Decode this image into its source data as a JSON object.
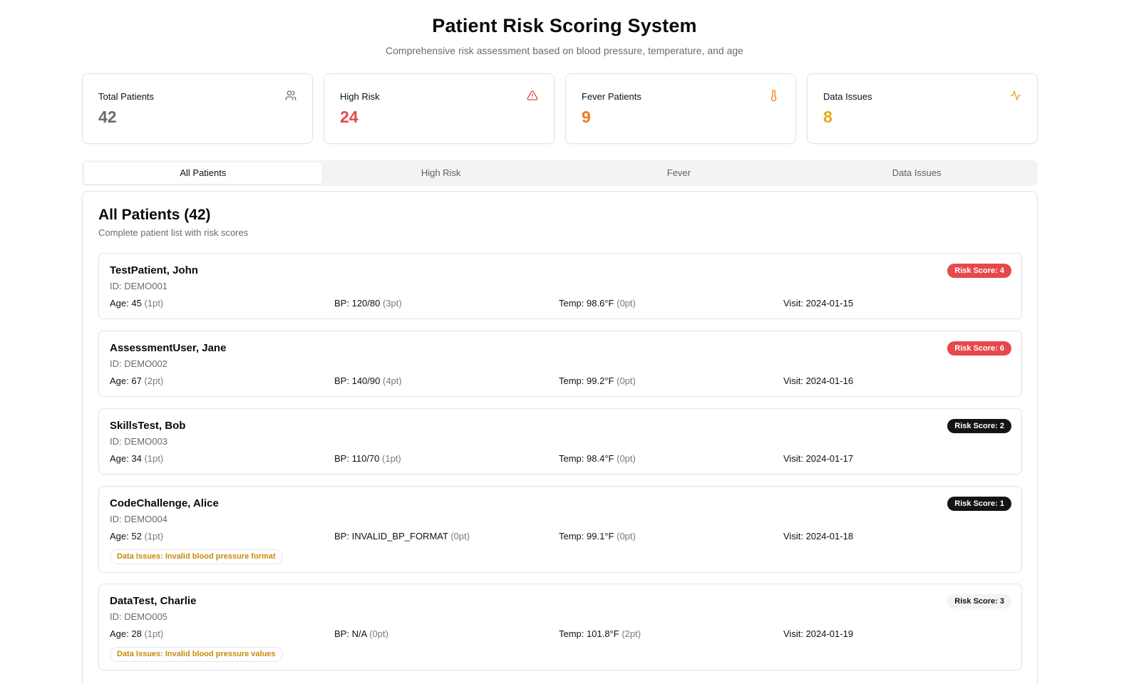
{
  "header": {
    "title": "Patient Risk Scoring System",
    "subtitle": "Comprehensive risk assessment based on blood pressure, temperature, and age"
  },
  "stats": [
    {
      "label": "Total Patients",
      "value": "42",
      "icon": "users-icon",
      "color": "#6b6b6b"
    },
    {
      "label": "High Risk",
      "value": "24",
      "icon": "alert-triangle-icon",
      "color": "#e5484d"
    },
    {
      "label": "Fever Patients",
      "value": "9",
      "icon": "thermometer-icon",
      "color": "#f27a1a"
    },
    {
      "label": "Data Issues",
      "value": "8",
      "icon": "activity-icon",
      "color": "#e6a817"
    }
  ],
  "tabs": [
    {
      "label": "All Patients",
      "active": true
    },
    {
      "label": "High Risk",
      "active": false
    },
    {
      "label": "Fever",
      "active": false
    },
    {
      "label": "Data Issues",
      "active": false
    }
  ],
  "panel": {
    "title": "All Patients (42)",
    "subtitle": "Complete patient list with risk scores"
  },
  "labels": {
    "age": "Age:",
    "bp": "BP:",
    "temp": "Temp:",
    "visit": "Visit:"
  },
  "patients": [
    {
      "name": "TestPatient, John",
      "id": "ID: DEMO001",
      "age": "45",
      "age_pt": "(1pt)",
      "bp": "120/80",
      "bp_pt": "(3pt)",
      "temp": "98.6°F",
      "temp_pt": "(0pt)",
      "visit": "2024-01-15",
      "risk": "Risk Score: 4",
      "risk_level": "high",
      "issue": ""
    },
    {
      "name": "AssessmentUser, Jane",
      "id": "ID: DEMO002",
      "age": "67",
      "age_pt": "(2pt)",
      "bp": "140/90",
      "bp_pt": "(4pt)",
      "temp": "99.2°F",
      "temp_pt": "(0pt)",
      "visit": "2024-01-16",
      "risk": "Risk Score: 6",
      "risk_level": "high",
      "issue": ""
    },
    {
      "name": "SkillsTest, Bob",
      "id": "ID: DEMO003",
      "age": "34",
      "age_pt": "(1pt)",
      "bp": "110/70",
      "bp_pt": "(1pt)",
      "temp": "98.4°F",
      "temp_pt": "(0pt)",
      "visit": "2024-01-17",
      "risk": "Risk Score: 2",
      "risk_level": "dark",
      "issue": ""
    },
    {
      "name": "CodeChallenge, Alice",
      "id": "ID: DEMO004",
      "age": "52",
      "age_pt": "(1pt)",
      "bp": "INVALID_BP_FORMAT",
      "bp_pt": "(0pt)",
      "temp": "99.1°F",
      "temp_pt": "(0pt)",
      "visit": "2024-01-18",
      "risk": "Risk Score: 1",
      "risk_level": "dark",
      "issue": "Data Issues: Invalid blood pressure format"
    },
    {
      "name": "DataTest, Charlie",
      "id": "ID: DEMO005",
      "age": "28",
      "age_pt": "(1pt)",
      "bp": "N/A",
      "bp_pt": "(0pt)",
      "temp": "101.8°F",
      "temp_pt": "(2pt)",
      "visit": "2024-01-19",
      "risk": "Risk Score: 3",
      "risk_level": "light",
      "issue": "Data Issues: Invalid blood pressure values"
    }
  ],
  "colors": {
    "high": "#e5484d",
    "dark": "#141414",
    "light": "#f3f3f3",
    "issue": "#c98a0b"
  }
}
